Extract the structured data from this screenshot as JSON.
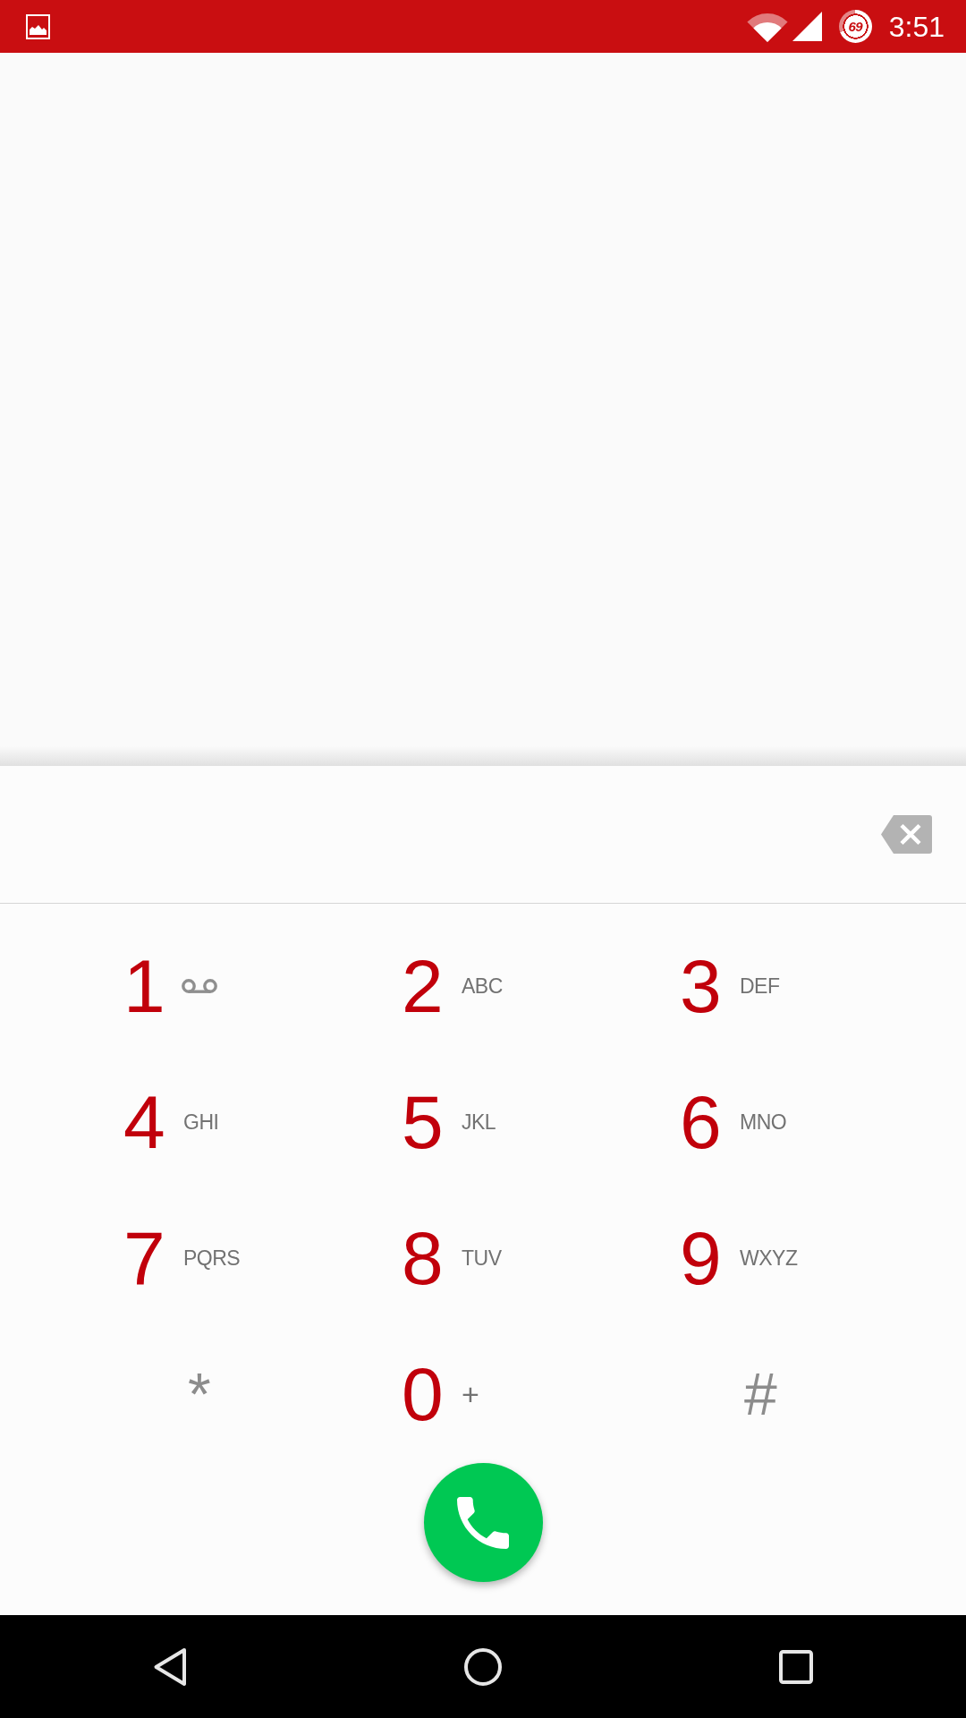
{
  "status_bar": {
    "battery": "69",
    "time": "3:51"
  },
  "keypad": {
    "keys": [
      {
        "kind": "voicemail",
        "digit": "1"
      },
      {
        "kind": "letters",
        "digit": "2",
        "letters": "ABC"
      },
      {
        "kind": "letters",
        "digit": "3",
        "letters": "DEF"
      },
      {
        "kind": "letters",
        "digit": "4",
        "letters": "GHI"
      },
      {
        "kind": "letters",
        "digit": "5",
        "letters": "JKL"
      },
      {
        "kind": "letters",
        "digit": "6",
        "letters": "MNO"
      },
      {
        "kind": "letters",
        "digit": "7",
        "letters": "PQRS"
      },
      {
        "kind": "letters",
        "digit": "8",
        "letters": "TUV"
      },
      {
        "kind": "letters",
        "digit": "9",
        "letters": "WXYZ"
      },
      {
        "kind": "symbol",
        "digit": "*"
      },
      {
        "kind": "plus",
        "digit": "0",
        "letters": "+"
      },
      {
        "kind": "symbol",
        "digit": "#"
      }
    ]
  }
}
